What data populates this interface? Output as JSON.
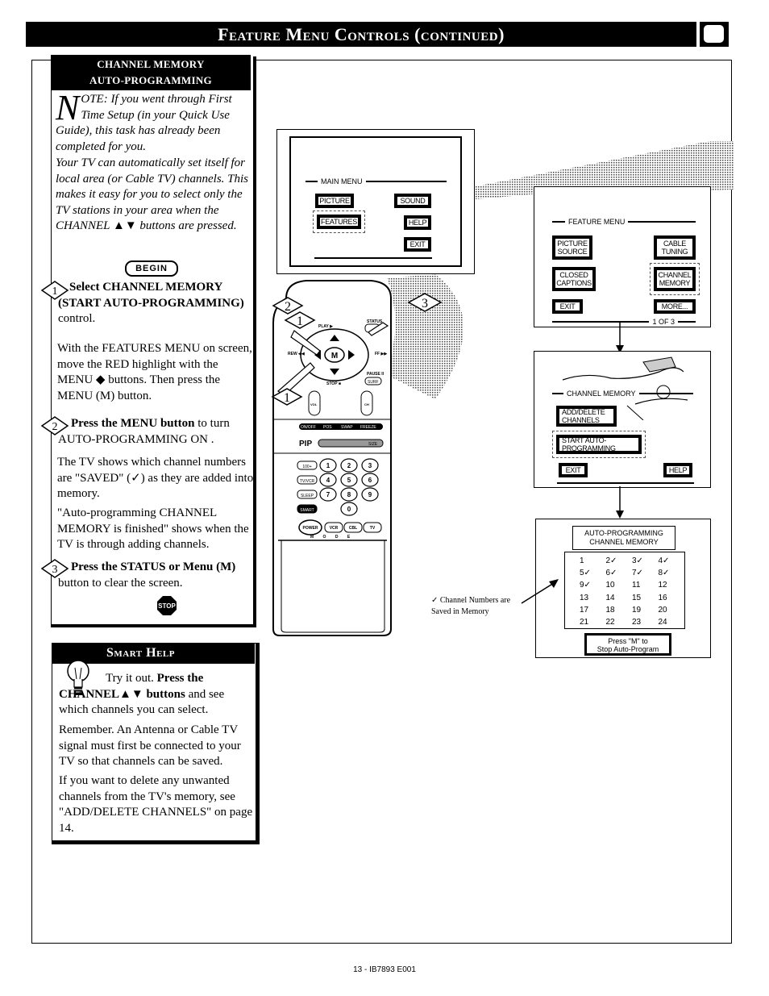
{
  "header": {
    "title": "Feature Menu Controls (continued)"
  },
  "section": {
    "title_line1": "CHANNEL MEMORY",
    "title_line2": "AUTO-PROGRAMMING",
    "note_dropcap": "N",
    "note_text": "OTE: If you went through First Time Setup (in your Quick Use Guide), this task has already been completed for you.",
    "intro_text": "Your TV can automatically set itself for local area (or Cable TV) channels. This makes it easy for you to select only the TV stations in your area when the CHANNEL ▲▼ buttons are pressed.",
    "begin_label": "BEGIN",
    "steps": [
      {
        "number": "1",
        "heading_bold": "Select CHANNEL MEMORY (START AUTO-PROGRAMMING)",
        "heading_rest": " control.",
        "body": "With the FEATURES MENU on screen, move the RED highlight with the MENU ◆ buttons. Then press the MENU (M) button."
      },
      {
        "number": "2",
        "heading_bold": "Press the MENU button",
        "heading_rest": " to turn AUTO-PROGRAMMING ON .",
        "body": "The TV shows which channel numbers are \"SAVED\" (✓) as they are added into memory.",
        "body2": "\"Auto-programming CHANNEL MEMORY is finished\" shows when the TV is through adding channels."
      },
      {
        "number": "3",
        "heading_bold": "Press the STATUS or Menu (M)",
        "heading_rest": " button to clear the screen."
      }
    ],
    "stop_label": "STOP"
  },
  "smart_help": {
    "title": "Smart Help",
    "p1_plain": "Try it out. ",
    "p1_bold": "Press the CHANNEL▲▼ buttons",
    "p1_rest": " and see which channels you can select.",
    "p2": "Remember. An Antenna or Cable TV signal must first be connected to your TV so that channels can be saved.",
    "p3": "If you want to delete any unwanted channels from the TV's memory, see \"ADD/DELETE CHANNELS\" on page 14."
  },
  "main_menu": {
    "title": "MAIN MENU",
    "buttons": [
      "PICTURE",
      "SOUND",
      "FEATURES",
      "HELP",
      "EXIT"
    ],
    "highlighted": "FEATURES"
  },
  "feature_menu": {
    "title": "FEATURE MENU",
    "buttons": [
      "PICTURE SOURCE",
      "CABLE TUNING",
      "CLOSED CAPTIONS",
      "CHANNEL MEMORY",
      "EXIT",
      "MORE..."
    ],
    "highlighted": "CHANNEL MEMORY",
    "page_indicator": "1 OF 3"
  },
  "channel_memory_menu": {
    "title": "CHANNEL MEMORY",
    "buttons": [
      "ADD/DELETE CHANNELS",
      "START AUTO-PROGRAMMING",
      "EXIT",
      "HELP"
    ],
    "highlighted": "START AUTO-PROGRAMMING"
  },
  "auto_programming_screen": {
    "title_line1": "AUTO-PROGRAMMING",
    "title_line2": "CHANNEL MEMORY",
    "channels": [
      {
        "n": "1",
        "saved": false
      },
      {
        "n": "2",
        "saved": true
      },
      {
        "n": "3",
        "saved": true
      },
      {
        "n": "4",
        "saved": true
      },
      {
        "n": "5",
        "saved": true
      },
      {
        "n": "6",
        "saved": true
      },
      {
        "n": "7",
        "saved": true
      },
      {
        "n": "8",
        "saved": true
      },
      {
        "n": "9",
        "saved": true
      },
      {
        "n": "10",
        "saved": false
      },
      {
        "n": "11",
        "saved": false
      },
      {
        "n": "12",
        "saved": false
      },
      {
        "n": "13",
        "saved": false
      },
      {
        "n": "14",
        "saved": false
      },
      {
        "n": "15",
        "saved": false
      },
      {
        "n": "16",
        "saved": false
      },
      {
        "n": "17",
        "saved": false
      },
      {
        "n": "18",
        "saved": false
      },
      {
        "n": "19",
        "saved": false
      },
      {
        "n": "20",
        "saved": false
      },
      {
        "n": "21",
        "saved": false
      },
      {
        "n": "22",
        "saved": false
      },
      {
        "n": "23",
        "saved": false
      },
      {
        "n": "24",
        "saved": false
      }
    ],
    "footer_line1": "Press \"M\" to",
    "footer_line2": "Stop Auto-Program"
  },
  "caption": {
    "line1": "✓ Channel Numbers are",
    "line2": "Saved in Memory"
  },
  "remote": {
    "step_markers": [
      "2",
      "1",
      "3",
      "1"
    ],
    "labels": {
      "play": "PLAY ▶",
      "status": "STATUS",
      "rew": "REW ◀◀",
      "ff": "FF ▶▶",
      "menu": "M",
      "stop": "STOP ■",
      "pause": "PAUSE II",
      "surf": "SURF",
      "vol": "VOL",
      "ch": "CH",
      "pip_row": [
        "ON/OFF",
        "POS",
        "SWAP",
        "FREEZE"
      ],
      "pip": "PIP",
      "size": "SIZE",
      "left_keys": [
        "100+",
        "TV/VCR",
        "SLEEP",
        "SMART"
      ],
      "digits": [
        "1",
        "2",
        "3",
        "4",
        "5",
        "6",
        "7",
        "8",
        "9",
        "0"
      ],
      "power": "POWER",
      "modes": [
        "VCR",
        "CBL",
        "TV"
      ],
      "mode_label": "M O D E"
    }
  },
  "footer": {
    "page_code": "13 - IB7893 E001"
  }
}
